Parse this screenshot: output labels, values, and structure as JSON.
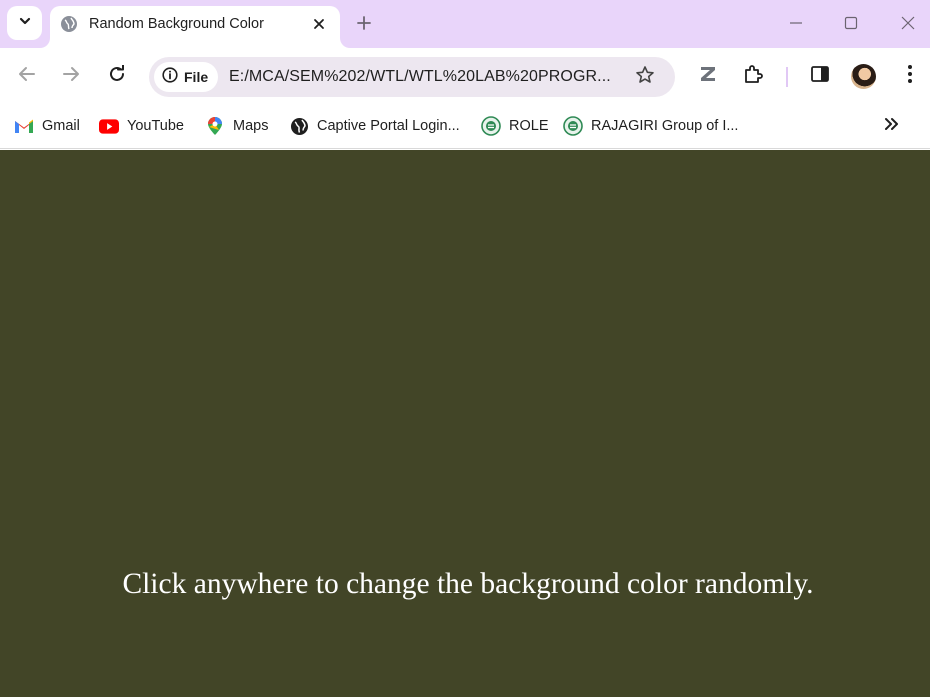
{
  "browser": {
    "tab": {
      "title": "Random Background Color"
    },
    "address": {
      "security_chip": "File",
      "url": "E:/MCA/SEM%202/WTL/WTL%20LAB%20PROGR..."
    },
    "bookmarks": [
      {
        "label": "Gmail",
        "icon": "gmail-icon"
      },
      {
        "label": "YouTube",
        "icon": "youtube-icon"
      },
      {
        "label": "Maps",
        "icon": "maps-icon"
      },
      {
        "label": "Captive Portal Login...",
        "icon": "globe-icon"
      },
      {
        "label": "ROLE",
        "icon": "role-logo-icon"
      },
      {
        "label": "RAJAGIRI Group of I...",
        "icon": "rajagiri-logo-icon"
      }
    ],
    "colors": {
      "tabstrip": "#e9d5fa",
      "omnibox": "#ede7f0"
    }
  },
  "page": {
    "background": "#424527",
    "instruction": "Click anywhere to change the background color randomly."
  }
}
